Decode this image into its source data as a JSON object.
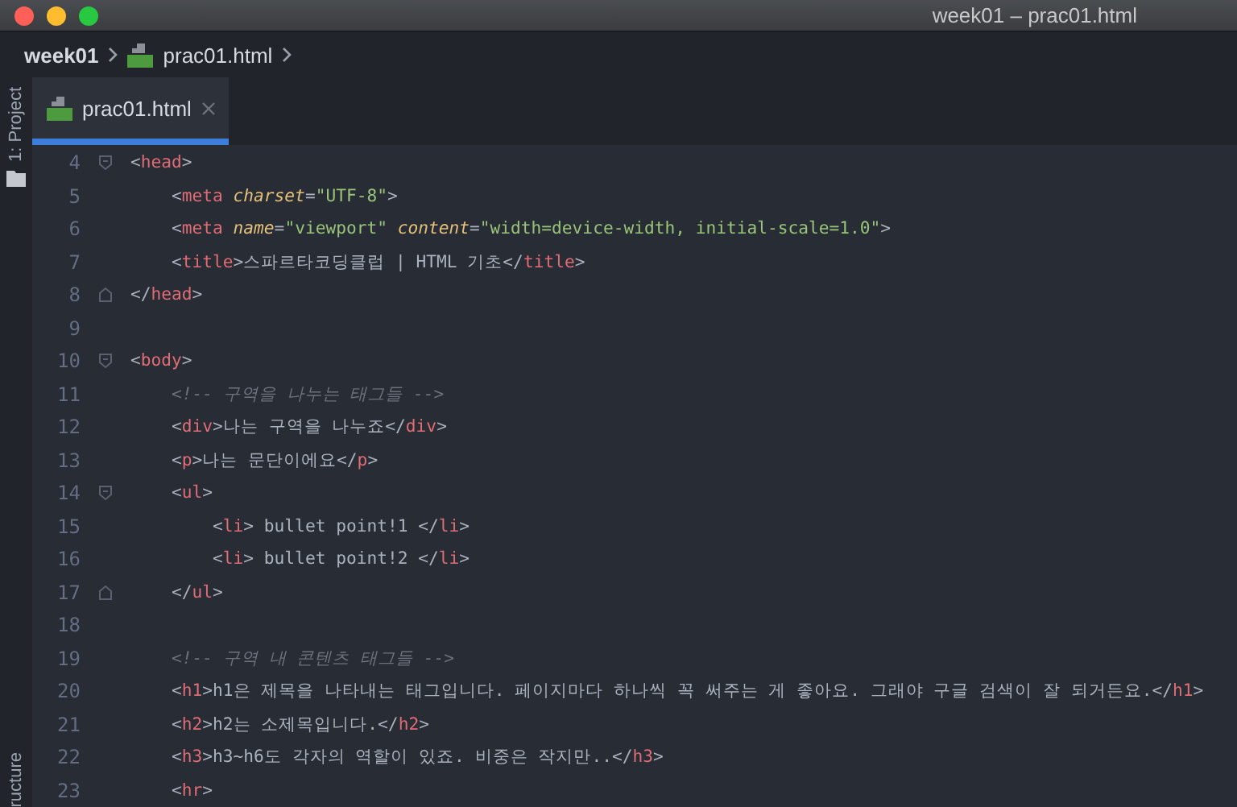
{
  "window": {
    "title": "week01 – prac01.html"
  },
  "breadcrumb": [
    {
      "label": "week01",
      "kind": "folder"
    },
    {
      "label": "prac01.html",
      "kind": "file"
    }
  ],
  "side_strip": {
    "top_label": "1: Project",
    "bottom_label": "ructure"
  },
  "tabs": [
    {
      "label": "prac01.html",
      "selected": true
    }
  ],
  "editor": {
    "lines": [
      {
        "number": "4",
        "kind": "foldstart",
        "tokens": [
          {
            "kind": "punct",
            "text": "<"
          },
          {
            "kind": "tag",
            "text": "head"
          },
          {
            "kind": "punct",
            "text": ">"
          }
        ]
      },
      {
        "number": "5",
        "kind": "plain",
        "tokens": [
          {
            "kind": "punct",
            "text": "    <"
          },
          {
            "kind": "tag",
            "text": "meta "
          },
          {
            "kind": "attr",
            "text": "charset"
          },
          {
            "kind": "punct",
            "text": "="
          },
          {
            "kind": "str",
            "text": "\"UTF-8\""
          },
          {
            "kind": "punct",
            "text": ">"
          }
        ]
      },
      {
        "number": "6",
        "kind": "plain",
        "tokens": [
          {
            "kind": "punct",
            "text": "    <"
          },
          {
            "kind": "tag",
            "text": "meta "
          },
          {
            "kind": "attr",
            "text": "name"
          },
          {
            "kind": "punct",
            "text": "="
          },
          {
            "kind": "str",
            "text": "\"viewport\" "
          },
          {
            "kind": "attr",
            "text": "content"
          },
          {
            "kind": "punct",
            "text": "="
          },
          {
            "kind": "str",
            "text": "\"width=device-width, initial-scale=1.0\""
          },
          {
            "kind": "punct",
            "text": ">"
          }
        ]
      },
      {
        "number": "7",
        "kind": "plain",
        "tokens": [
          {
            "kind": "punct",
            "text": "    <"
          },
          {
            "kind": "tag",
            "text": "title"
          },
          {
            "kind": "punct",
            "text": ">스파르타코딩클럽 | HTML 기초</"
          },
          {
            "kind": "tag",
            "text": "title"
          },
          {
            "kind": "punct",
            "text": ">"
          }
        ]
      },
      {
        "number": "8",
        "kind": "foldend",
        "tokens": [
          {
            "kind": "punct",
            "text": "</"
          },
          {
            "kind": "tag",
            "text": "head"
          },
          {
            "kind": "punct",
            "text": ">"
          }
        ]
      },
      {
        "number": "9",
        "kind": "plain"
      },
      {
        "number": "10",
        "kind": "foldstart",
        "tokens": [
          {
            "kind": "punct",
            "text": "<"
          },
          {
            "kind": "tag",
            "text": "body"
          },
          {
            "kind": "punct",
            "text": ">"
          }
        ]
      },
      {
        "number": "11",
        "kind": "plain",
        "tokens": [
          {
            "kind": "comment",
            "text": "    <!-- 구역을 나누는 태그들 -->"
          }
        ]
      },
      {
        "number": "12",
        "kind": "plain",
        "tokens": [
          {
            "kind": "punct",
            "text": "    <"
          },
          {
            "kind": "tag",
            "text": "div"
          },
          {
            "kind": "punct",
            "text": ">나는 구역을 나누죠</"
          },
          {
            "kind": "tag",
            "text": "div"
          },
          {
            "kind": "punct",
            "text": ">"
          }
        ]
      },
      {
        "number": "13",
        "kind": "plain",
        "tokens": [
          {
            "kind": "punct",
            "text": "    <"
          },
          {
            "kind": "tag",
            "text": "p"
          },
          {
            "kind": "punct",
            "text": ">나는 문단이에요</"
          },
          {
            "kind": "tag",
            "text": "p"
          },
          {
            "kind": "punct",
            "text": ">"
          }
        ]
      },
      {
        "number": "14",
        "kind": "foldstart",
        "tokens": [
          {
            "kind": "punct",
            "text": "    <"
          },
          {
            "kind": "tag",
            "text": "ul"
          },
          {
            "kind": "punct",
            "text": ">"
          }
        ]
      },
      {
        "number": "15",
        "kind": "plain",
        "tokens": [
          {
            "kind": "punct",
            "text": "        <"
          },
          {
            "kind": "tag",
            "text": "li"
          },
          {
            "kind": "punct",
            "text": "> bullet point!1 </"
          },
          {
            "kind": "tag",
            "text": "li"
          },
          {
            "kind": "punct",
            "text": ">"
          }
        ]
      },
      {
        "number": "16",
        "kind": "plain",
        "tokens": [
          {
            "kind": "punct",
            "text": "        <"
          },
          {
            "kind": "tag",
            "text": "li"
          },
          {
            "kind": "punct",
            "text": "> bullet point!2 </"
          },
          {
            "kind": "tag",
            "text": "li"
          },
          {
            "kind": "punct",
            "text": ">"
          }
        ]
      },
      {
        "number": "17",
        "kind": "foldend",
        "tokens": [
          {
            "kind": "punct",
            "text": "    </"
          },
          {
            "kind": "tag",
            "text": "ul"
          },
          {
            "kind": "punct",
            "text": ">"
          }
        ]
      },
      {
        "number": "18",
        "kind": "plain"
      },
      {
        "number": "19",
        "kind": "plain",
        "tokens": [
          {
            "kind": "comment",
            "text": "    <!-- 구역 내 콘텐츠 태그들 -->"
          }
        ]
      },
      {
        "number": "20",
        "kind": "plain",
        "tokens": [
          {
            "kind": "punct",
            "text": "    <"
          },
          {
            "kind": "tag",
            "text": "h1"
          },
          {
            "kind": "punct",
            "text": ">h1은 제목을 나타내는 태그입니다. 페이지마다 하나씩 꼭 써주는 게 좋아요. 그래야 구글 검색이 잘 되거든요.</"
          },
          {
            "kind": "tag",
            "text": "h1"
          },
          {
            "kind": "punct",
            "text": ">"
          }
        ]
      },
      {
        "number": "21",
        "kind": "plain",
        "tokens": [
          {
            "kind": "punct",
            "text": "    <"
          },
          {
            "kind": "tag",
            "text": "h2"
          },
          {
            "kind": "punct",
            "text": ">h2는 소제목입니다.</"
          },
          {
            "kind": "tag",
            "text": "h2"
          },
          {
            "kind": "punct",
            "text": ">"
          }
        ]
      },
      {
        "number": "22",
        "kind": "plain",
        "tokens": [
          {
            "kind": "punct",
            "text": "    <"
          },
          {
            "kind": "tag",
            "text": "h3"
          },
          {
            "kind": "punct",
            "text": ">h3~h6도 각자의 역할이 있죠. 비중은 작지만..</"
          },
          {
            "kind": "tag",
            "text": "h3"
          },
          {
            "kind": "punct",
            "text": ">"
          }
        ]
      },
      {
        "number": "23",
        "kind": "plain",
        "tokens": [
          {
            "kind": "punct",
            "text": "    <"
          },
          {
            "kind": "tag",
            "text": "hr"
          },
          {
            "kind": "punct",
            "text": ">"
          }
        ]
      }
    ]
  }
}
